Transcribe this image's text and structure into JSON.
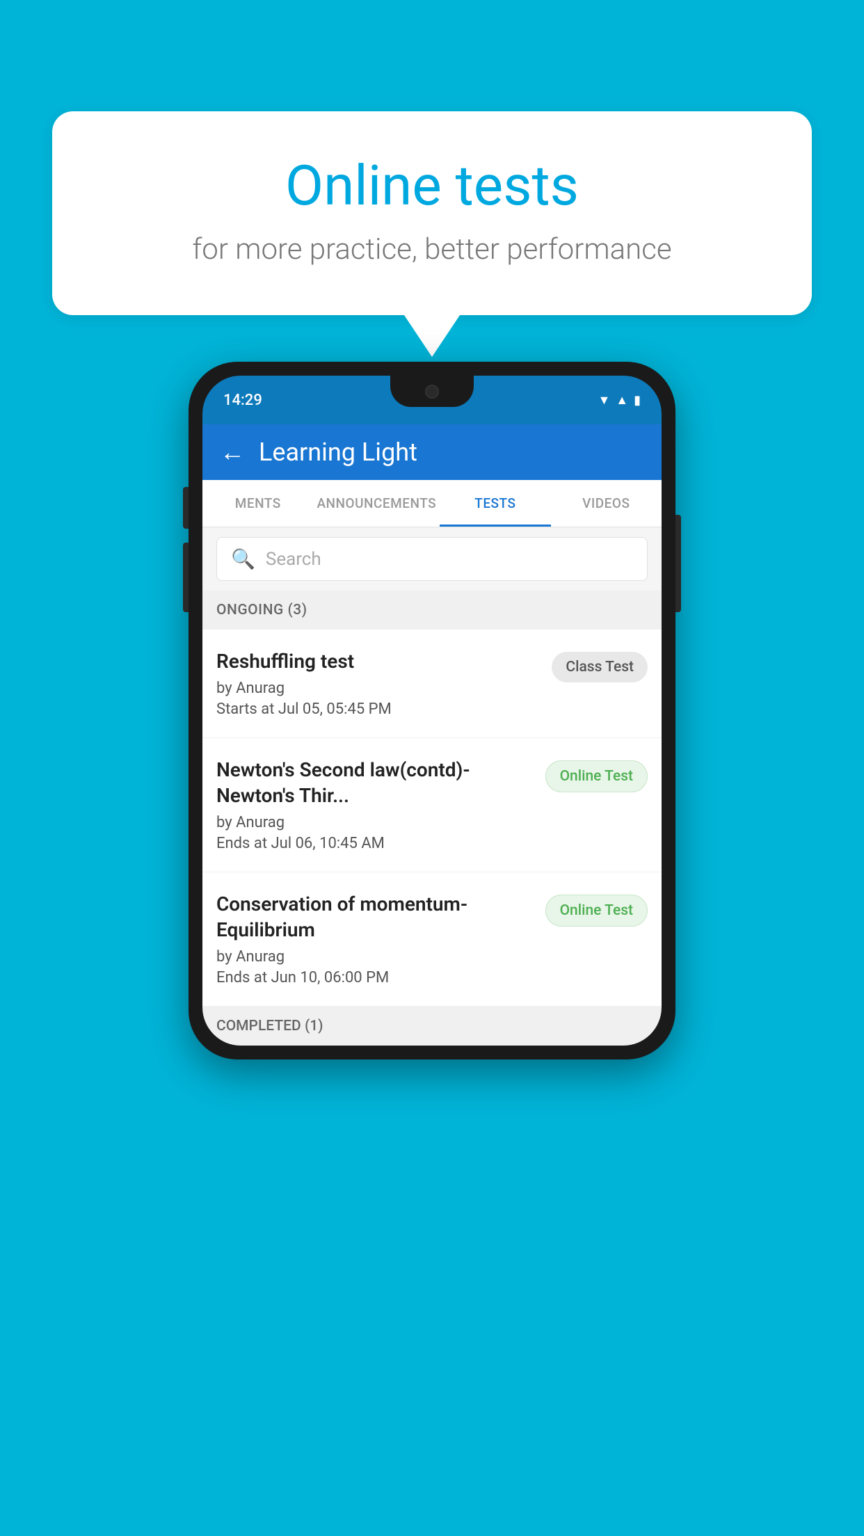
{
  "background": {
    "color": "#00b4d8"
  },
  "speech_bubble": {
    "title": "Online tests",
    "subtitle": "for more practice, better performance"
  },
  "phone": {
    "status_bar": {
      "time": "14:29",
      "icons": [
        "wifi",
        "signal",
        "battery"
      ]
    },
    "app_header": {
      "back_label": "←",
      "title": "Learning Light"
    },
    "tabs": [
      {
        "label": "MENTS",
        "active": false
      },
      {
        "label": "ANNOUNCEMENTS",
        "active": false
      },
      {
        "label": "TESTS",
        "active": true
      },
      {
        "label": "VIDEOS",
        "active": false
      }
    ],
    "search": {
      "placeholder": "Search",
      "icon": "🔍"
    },
    "ongoing_section": {
      "header": "ONGOING (3)",
      "items": [
        {
          "name": "Reshuffling test",
          "author": "by Anurag",
          "date": "Starts at  Jul 05, 05:45 PM",
          "badge": "Class Test",
          "badge_type": "class"
        },
        {
          "name": "Newton's Second law(contd)-Newton's Thir...",
          "author": "by Anurag",
          "date": "Ends at  Jul 06, 10:45 AM",
          "badge": "Online Test",
          "badge_type": "online"
        },
        {
          "name": "Conservation of momentum-Equilibrium",
          "author": "by Anurag",
          "date": "Ends at  Jun 10, 06:00 PM",
          "badge": "Online Test",
          "badge_type": "online"
        }
      ]
    },
    "completed_section": {
      "header": "COMPLETED (1)"
    }
  }
}
